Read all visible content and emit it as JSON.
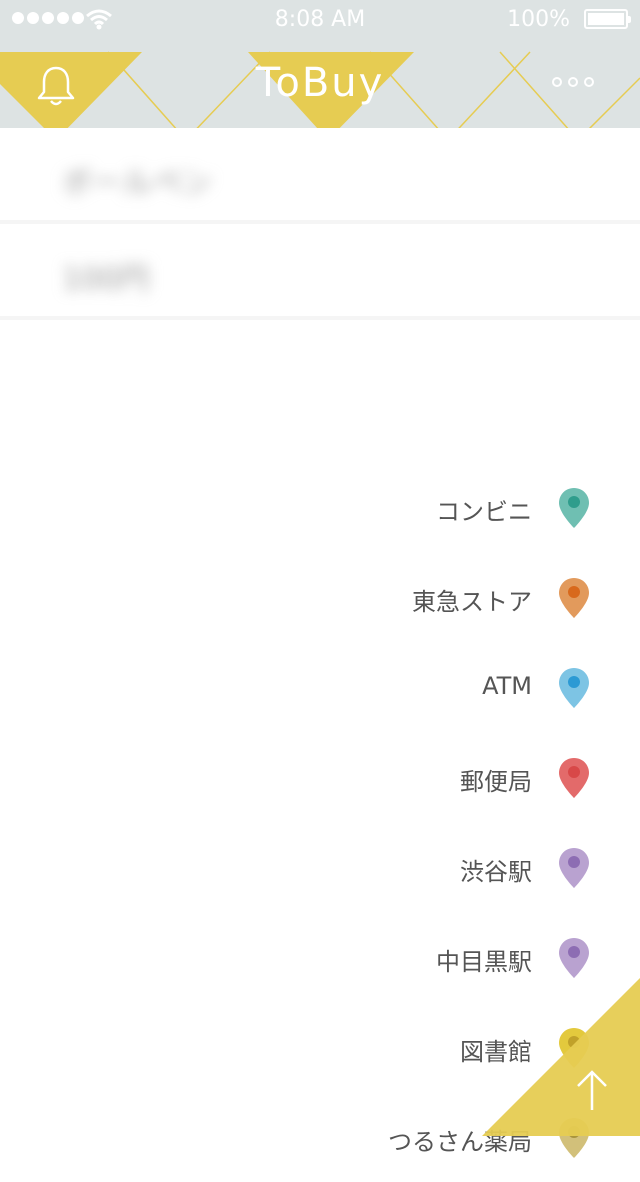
{
  "status_bar": {
    "time": "8:08 AM",
    "battery": "100%"
  },
  "header": {
    "title": "ToBuy"
  },
  "blurred_items": [
    {
      "label": "ボールペン"
    },
    {
      "label": "100円"
    }
  ],
  "locations": [
    {
      "label": "コンビニ",
      "color": "#6fbfb2",
      "dot": "#2f9d8c"
    },
    {
      "label": "東急ストア",
      "color": "#e29a5c",
      "dot": "#d8691c"
    },
    {
      "label": "ATM",
      "color": "#7dc4e4",
      "dot": "#2c9ad4"
    },
    {
      "label": "郵便局",
      "color": "#e36a6a",
      "dot": "#d84848"
    },
    {
      "label": "渋谷駅",
      "color": "#b9a2d0",
      "dot": "#8d6db3"
    },
    {
      "label": "中目黒駅",
      "color": "#b9a2d0",
      "dot": "#8d6db3"
    },
    {
      "label": "図書館",
      "color": "#e3c93d",
      "dot": "#c0a12a"
    },
    {
      "label": "つるさん薬局",
      "color": "#d2c07a",
      "dot": "#a8943c"
    }
  ],
  "icons": {
    "bell": "bell-icon",
    "more": "more-icon",
    "scroll_top": "arrow-up-icon"
  },
  "colors": {
    "accent": "#e6cc52",
    "nav_bg": "#dde3e3"
  }
}
